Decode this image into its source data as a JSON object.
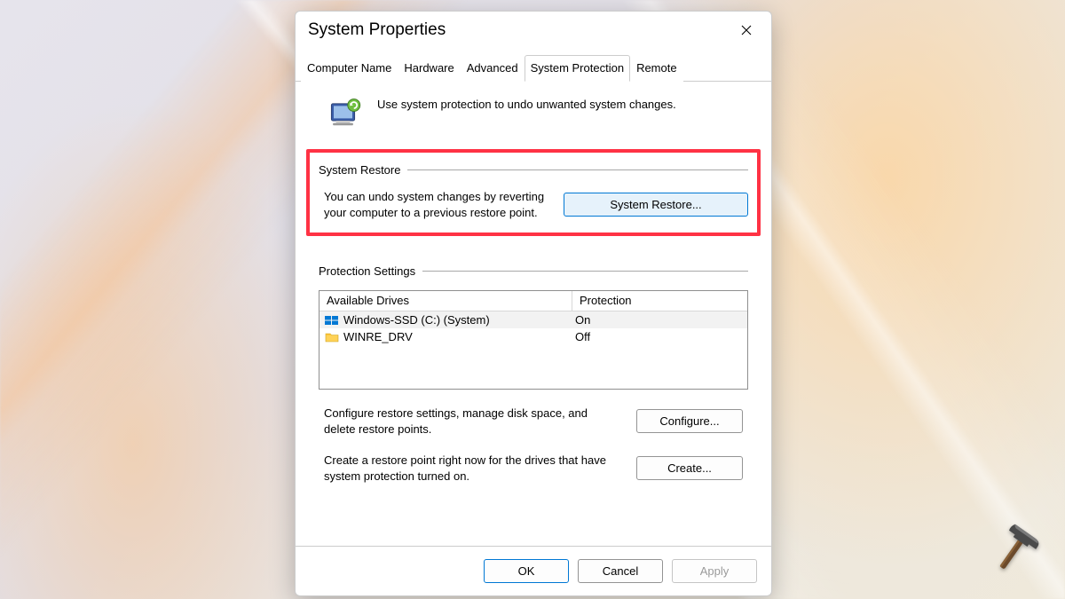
{
  "dialog": {
    "title": "System Properties",
    "tabs": [
      "Computer Name",
      "Hardware",
      "Advanced",
      "System Protection",
      "Remote"
    ],
    "active_tab_index": 3,
    "intro": "Use system protection to undo unwanted system changes.",
    "restore_group": {
      "label": "System Restore",
      "text": "You can undo system changes by reverting your computer to a previous restore point.",
      "button": "System Restore..."
    },
    "protection_group": {
      "label": "Protection Settings",
      "columns": {
        "drive": "Available Drives",
        "protection": "Protection"
      },
      "drives": [
        {
          "name": "Windows-SSD (C:) (System)",
          "protection": "On",
          "selected": true,
          "icon": "windows"
        },
        {
          "name": "WINRE_DRV",
          "protection": "Off",
          "selected": false,
          "icon": "folder"
        }
      ],
      "configure_text": "Configure restore settings, manage disk space, and delete restore points.",
      "configure_button": "Configure...",
      "create_text": "Create a restore point right now for the drives that have system protection turned on.",
      "create_button": "Create..."
    },
    "footer": {
      "ok": "OK",
      "cancel": "Cancel",
      "apply": "Apply"
    }
  }
}
